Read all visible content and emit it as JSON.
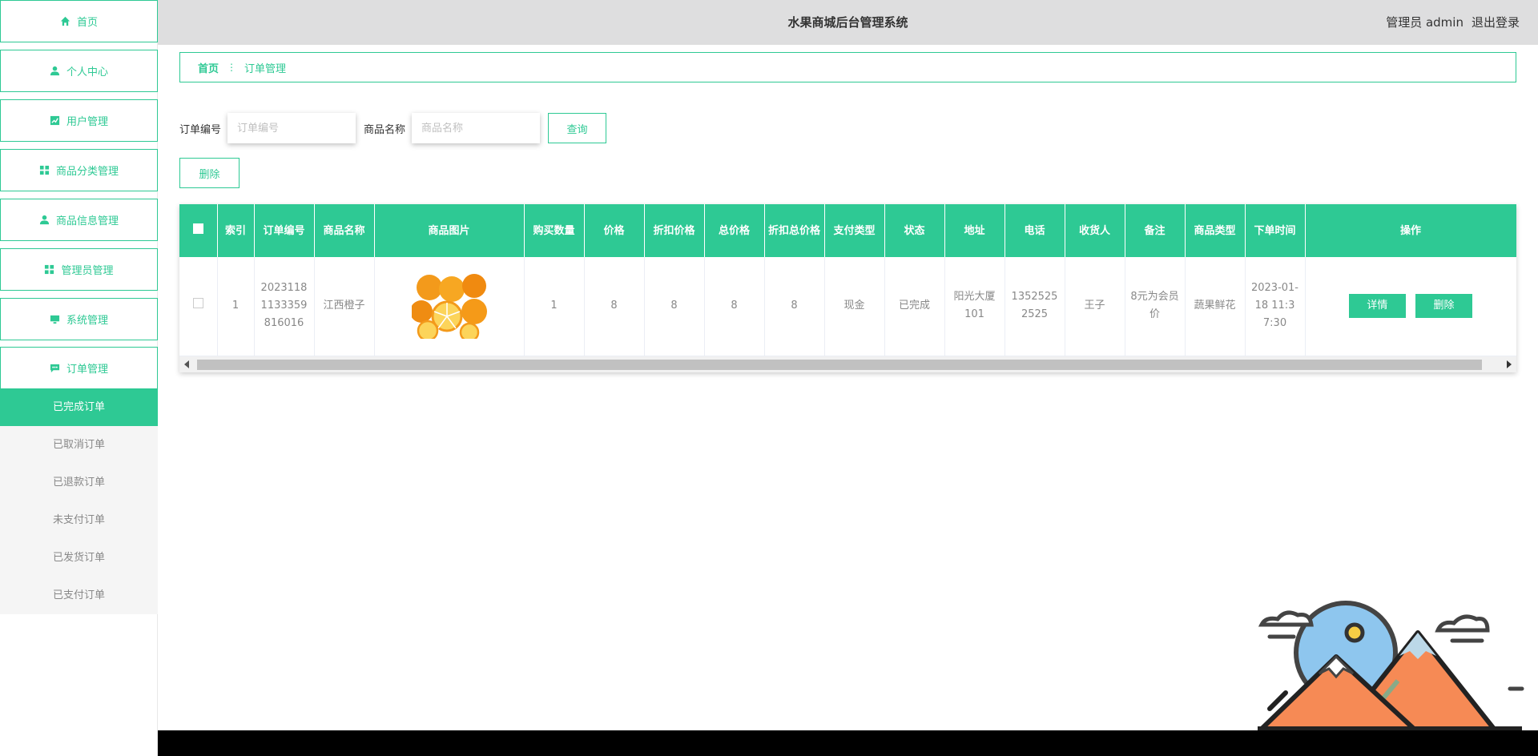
{
  "sidebar": {
    "items": [
      {
        "label": "首页",
        "icon": "home-icon"
      },
      {
        "label": "个人中心",
        "icon": "user-icon"
      },
      {
        "label": "用户管理",
        "icon": "chart-icon"
      },
      {
        "label": "商品分类管理",
        "icon": "grid-icon"
      },
      {
        "label": "商品信息管理",
        "icon": "user-icon"
      },
      {
        "label": "管理员管理",
        "icon": "grid-icon"
      },
      {
        "label": "系统管理",
        "icon": "monitor-icon"
      },
      {
        "label": "订单管理",
        "icon": "chat-icon"
      }
    ],
    "submenu": [
      {
        "label": "已完成订单",
        "active": true
      },
      {
        "label": "已取消订单"
      },
      {
        "label": "已退款订单"
      },
      {
        "label": "未支付订单"
      },
      {
        "label": "已发货订单"
      },
      {
        "label": "已支付订单"
      }
    ]
  },
  "header": {
    "title": "水果商城后台管理系统",
    "role": "管理员 admin",
    "logout": "退出登录"
  },
  "breadcrumb": {
    "home": "首页",
    "current": "订单管理"
  },
  "search": {
    "order_no_label": "订单编号",
    "order_no_placeholder": "订单编号",
    "goods_name_label": "商品名称",
    "goods_name_placeholder": "商品名称",
    "query_button": "查询"
  },
  "actions": {
    "delete_button": "删除"
  },
  "table": {
    "headers": [
      "索引",
      "订单编号",
      "商品名称",
      "商品图片",
      "购买数量",
      "价格",
      "折扣价格",
      "总价格",
      "折扣总价格",
      "支付类型",
      "状态",
      "地址",
      "电话",
      "收货人",
      "备注",
      "商品类型",
      "下单时间",
      "操作"
    ],
    "rows": [
      {
        "index": "1",
        "order_no": "20231181133359816016",
        "goods_name": "江西橙子",
        "quantity": "1",
        "price": "8",
        "discount_price": "8",
        "total": "8",
        "discount_total": "8",
        "pay_type": "现金",
        "status": "已完成",
        "address": "阳光大厦101",
        "phone": "13525252525",
        "receiver": "王子",
        "note": "8元为会员价",
        "goods_type": "蔬果鲜花",
        "order_time": "2023-01-18 11:37:30",
        "detail_button": "详情",
        "delete_button": "删除"
      }
    ]
  },
  "colors": {
    "accent": "#2ec994",
    "topbar": "#dededf"
  }
}
